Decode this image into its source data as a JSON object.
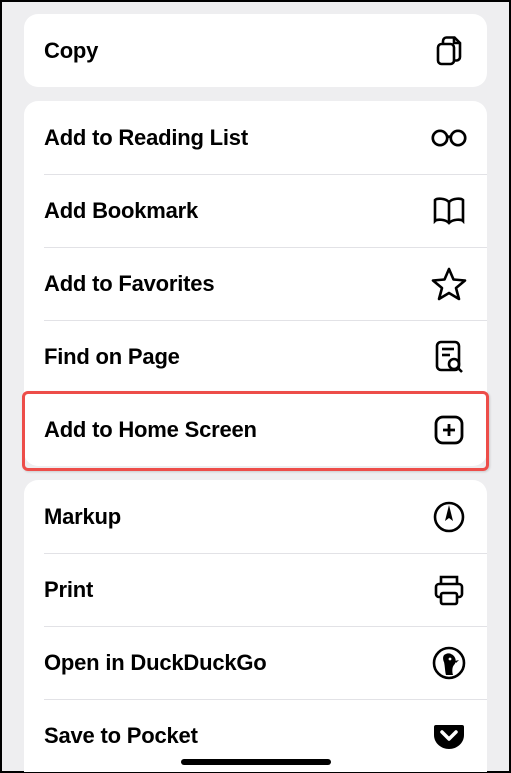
{
  "groups": [
    {
      "items": [
        {
          "id": "copy",
          "label": "Copy",
          "icon": "copy-icon"
        }
      ]
    },
    {
      "items": [
        {
          "id": "reading-list",
          "label": "Add to Reading List",
          "icon": "glasses-icon"
        },
        {
          "id": "bookmark",
          "label": "Add Bookmark",
          "icon": "book-icon"
        },
        {
          "id": "favorites",
          "label": "Add to Favorites",
          "icon": "star-icon"
        },
        {
          "id": "find",
          "label": "Find on Page",
          "icon": "find-icon"
        },
        {
          "id": "home-screen",
          "label": "Add to Home Screen",
          "icon": "plus-square-icon"
        }
      ]
    },
    {
      "items": [
        {
          "id": "markup",
          "label": "Markup",
          "icon": "markup-icon"
        },
        {
          "id": "print",
          "label": "Print",
          "icon": "printer-icon"
        },
        {
          "id": "duckduckgo",
          "label": "Open in DuckDuckGo",
          "icon": "duckduckgo-icon"
        },
        {
          "id": "pocket",
          "label": "Save to Pocket",
          "icon": "pocket-icon"
        }
      ]
    }
  ],
  "highlighted_item": "home-screen"
}
